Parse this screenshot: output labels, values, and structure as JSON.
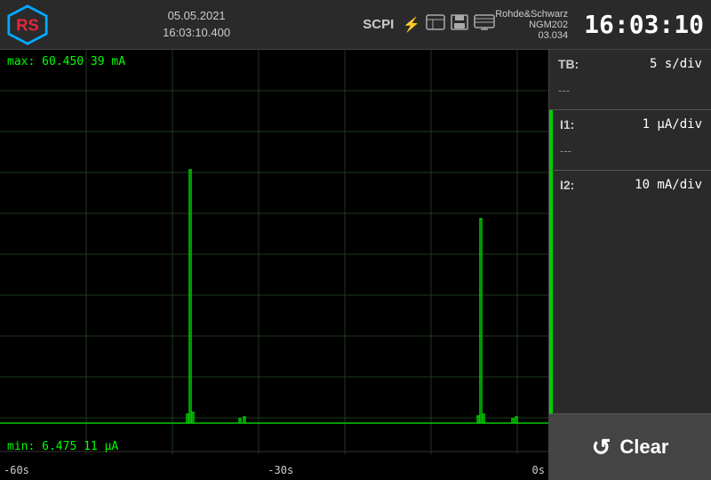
{
  "header": {
    "date": "05.05.2021",
    "time_logged": "16:03:10.400",
    "brand": "Rohde&Schwarz",
    "model": "NGM202",
    "firmware": "03.034",
    "current_time": "16:03:10",
    "scpi_label": "SCPI"
  },
  "chart": {
    "max_label": "max: 60.450 39 mA",
    "min_label": "min: 6.475 11 µA",
    "x_labels": [
      "-60s",
      "-30s",
      "0s"
    ]
  },
  "sidebar": {
    "tb_label": "TB:",
    "tb_value": "5 s/div",
    "tb_dash": "---",
    "i1_label": "I1:",
    "i1_value": "1 µA/div",
    "i1_dash": "---",
    "i2_label": "I2:",
    "i2_value": "10 mA/div"
  },
  "clear_button": {
    "label": "Clear"
  }
}
